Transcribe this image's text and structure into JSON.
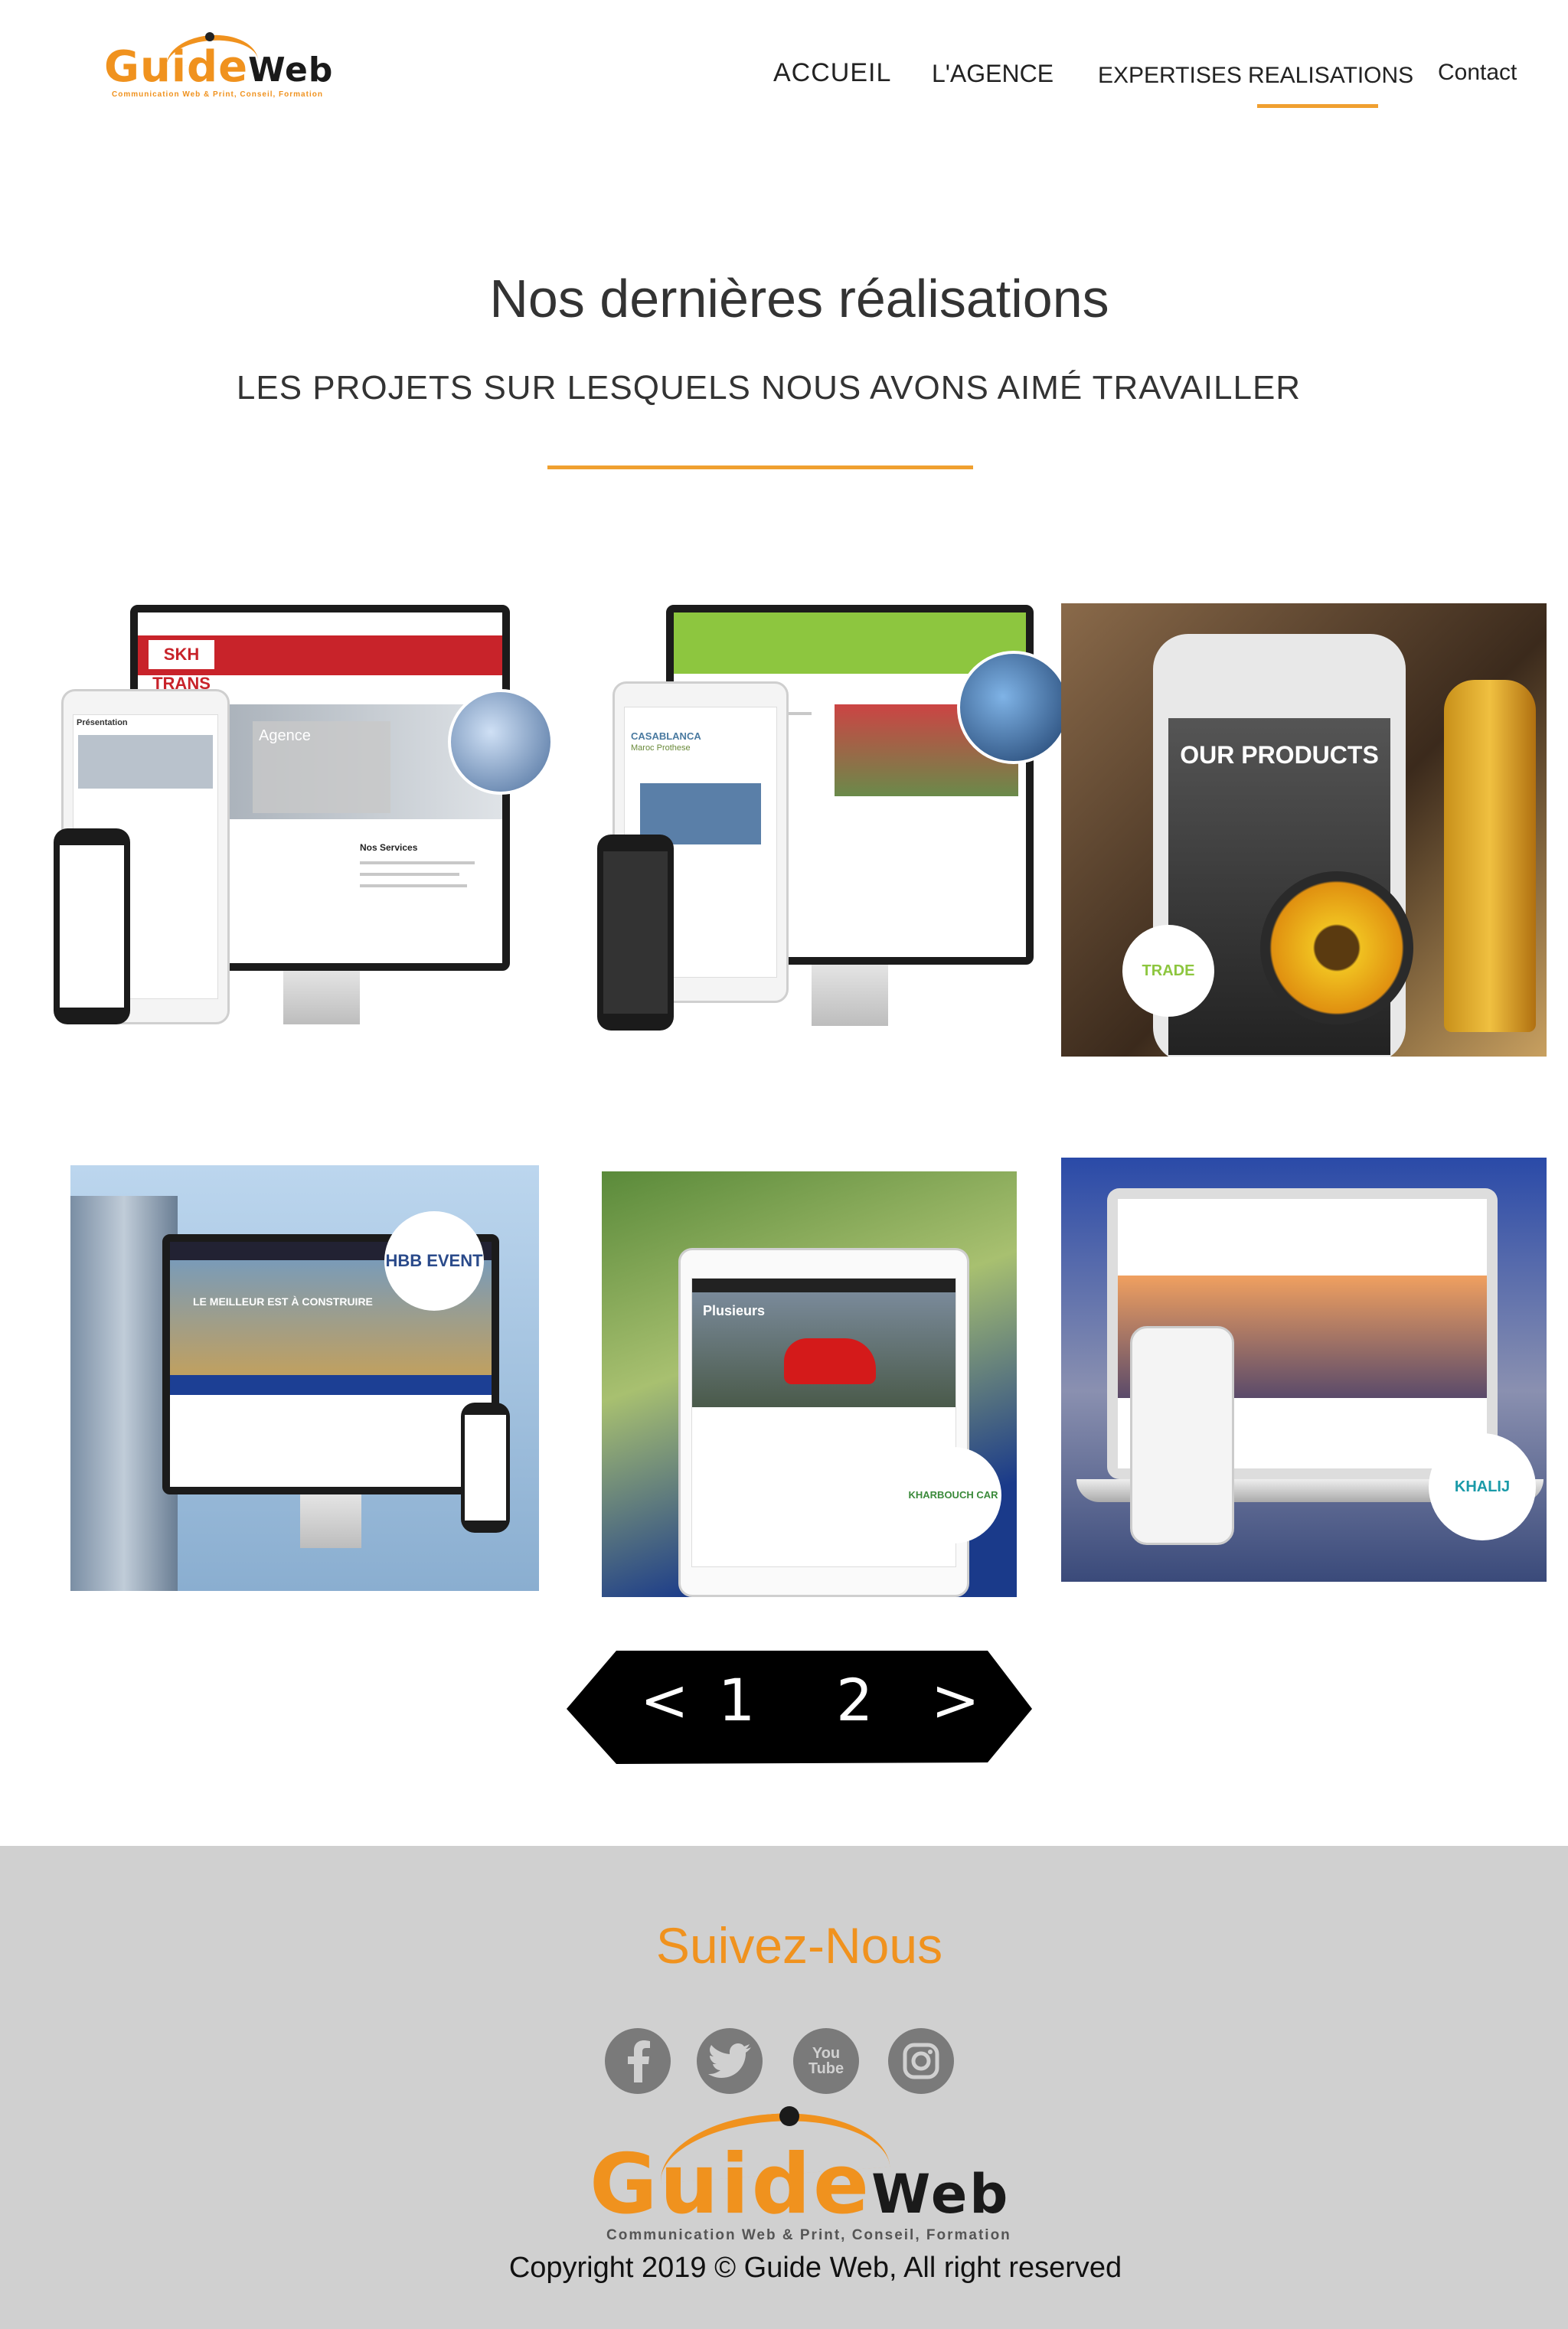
{
  "brand": {
    "logo_main": "Guide",
    "logo_suffix": "Web",
    "tagline": "Communication Web & Print, Conseil, Formation"
  },
  "nav": {
    "items": [
      "ACCUEIL",
      "L'AGENCE",
      "EXPERTISES",
      "REALISATIONS",
      "Contact"
    ],
    "active": "REALISATIONS"
  },
  "section": {
    "title": "Nos dernières réalisations",
    "subtitle": "LES PROJETS SUR LESQUELS NOUS AVONS AIMÉ TRAVAILLER"
  },
  "gallery": {
    "items": [
      {
        "brand_label": "SKH TRANS",
        "headline": "Agence",
        "side_title": "Nos Services",
        "intro": "Présentation"
      },
      {
        "brand_label": "CASABLANCA",
        "headline": "Maroc Prothese"
      },
      {
        "headline": "OUR PRODUCTS",
        "brand_label": "TRADE"
      },
      {
        "brand_label": "HBB EVENT",
        "headline": "LE MEILLEUR EST À CONSTRUIRE"
      },
      {
        "headline": "Plusieurs",
        "brand_label": "KHARBOUCH CAR"
      },
      {
        "brand_label": "KHALIJ"
      }
    ]
  },
  "pagination": {
    "prev": "<",
    "pages": [
      "1",
      "2"
    ],
    "next": ">"
  },
  "footer": {
    "follow_title": "Suivez-Nous",
    "social": [
      {
        "name": "facebook-icon",
        "glyph": "f"
      },
      {
        "name": "twitter-icon",
        "glyph": "t"
      },
      {
        "name": "youtube-icon",
        "glyph": "You Tube"
      },
      {
        "name": "instagram-icon",
        "glyph": ""
      }
    ],
    "copyright": "Copyright 2019 © Guide Web, All right reserved"
  },
  "colors": {
    "accent": "#f0a030",
    "brand_orange": "#f0921e",
    "footer_bg": "#d0d0d0"
  }
}
